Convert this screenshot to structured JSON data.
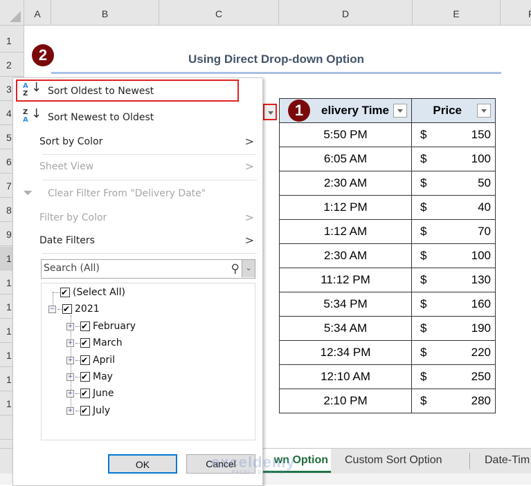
{
  "spreadsheet": {
    "columns": [
      "A",
      "B",
      "C",
      "D",
      "E",
      "F"
    ],
    "rows": [
      "1",
      "2",
      "3",
      "4",
      "5",
      "6",
      "7",
      "8",
      "9",
      "1",
      "1",
      "1",
      "1",
      "1",
      "1",
      "1",
      ""
    ],
    "title": "Using Direct Drop-down Option",
    "table": {
      "headers": {
        "time": "elivery Time",
        "price": "Price"
      },
      "rows": [
        {
          "time": "5:50 PM",
          "currency": "$",
          "price": "150"
        },
        {
          "time": "6:05 AM",
          "currency": "$",
          "price": "100"
        },
        {
          "time": "2:30 AM",
          "currency": "$",
          "price": "50"
        },
        {
          "time": "1:12 PM",
          "currency": "$",
          "price": "40"
        },
        {
          "time": "1:12 AM",
          "currency": "$",
          "price": "70"
        },
        {
          "time": "2:30 AM",
          "currency": "$",
          "price": "100"
        },
        {
          "time": "11:12 PM",
          "currency": "$",
          "price": "130"
        },
        {
          "time": "5:34 PM",
          "currency": "$",
          "price": "160"
        },
        {
          "time": "5:34 AM",
          "currency": "$",
          "price": "190"
        },
        {
          "time": "12:34 PM",
          "currency": "$",
          "price": "220"
        },
        {
          "time": "12:10 AM",
          "currency": "$",
          "price": "250"
        },
        {
          "time": "2:10 PM",
          "currency": "$",
          "price": "280"
        }
      ]
    }
  },
  "annotations": {
    "step1": "1",
    "step2": "2"
  },
  "filter_menu": {
    "sort_asc": "Sort Oldest to Newest",
    "sort_desc": "Sort Newest to Oldest",
    "sort_by_color": "Sort by Color",
    "sheet_view": "Sheet View",
    "clear_filter": "Clear Filter From \"Delivery Date\"",
    "filter_by_color": "Filter by Color",
    "date_filters": "Date Filters",
    "search_placeholder": "Search (All)",
    "tree": {
      "select_all": "(Select All)",
      "year": "2021",
      "months": [
        "February",
        "March",
        "April",
        "May",
        "June",
        "July"
      ]
    },
    "ok": "OK",
    "cancel": "Cancel"
  },
  "sheet_tabs": [
    {
      "label": "wn Option",
      "active": true
    },
    {
      "label": "Custom Sort Option",
      "active": false
    },
    {
      "label": "Date-Tim",
      "active": false
    }
  ],
  "watermark": {
    "brand": "exceldemy",
    "tagline": "EXCEL · DATA · BI"
  },
  "colors": {
    "accent_red": "#e02020",
    "badge": "#7a0a0a",
    "excel_green": "#217346",
    "ok_border": "#0078d7"
  }
}
